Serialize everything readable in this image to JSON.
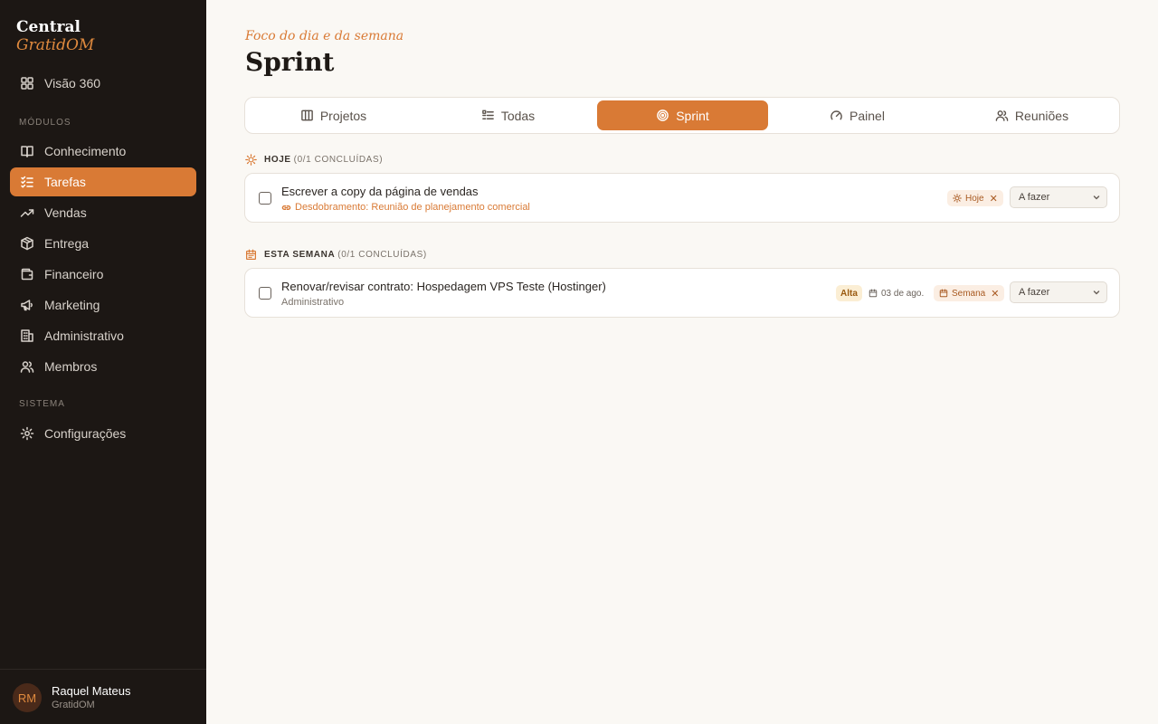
{
  "brand": {
    "line1": "Central",
    "line2": "GratidOM"
  },
  "sidebar": {
    "top_item": {
      "label": "Visão 360",
      "icon": "grid-icon"
    },
    "modules_label": "MÓDULOS",
    "modules": [
      {
        "label": "Conhecimento",
        "icon": "book-icon"
      },
      {
        "label": "Tarefas",
        "icon": "list-check-icon",
        "active": true
      },
      {
        "label": "Vendas",
        "icon": "trending-up-icon"
      },
      {
        "label": "Entrega",
        "icon": "package-icon"
      },
      {
        "label": "Financeiro",
        "icon": "wallet-icon"
      },
      {
        "label": "Marketing",
        "icon": "megaphone-icon"
      },
      {
        "label": "Administrativo",
        "icon": "building-icon"
      },
      {
        "label": "Membros",
        "icon": "users-icon"
      }
    ],
    "system_label": "SISTEMA",
    "system": [
      {
        "label": "Configurações",
        "icon": "gear-icon"
      }
    ]
  },
  "user": {
    "initials": "RM",
    "name": "Raquel Mateus",
    "org": "GratidOM"
  },
  "header": {
    "eyebrow": "Foco do dia e da semana",
    "title": "Sprint"
  },
  "tabs": [
    {
      "label": "Projetos",
      "icon": "columns-icon"
    },
    {
      "label": "Todas",
      "icon": "list-icon"
    },
    {
      "label": "Sprint",
      "icon": "target-icon",
      "active": true
    },
    {
      "label": "Painel",
      "icon": "gauge-icon"
    },
    {
      "label": "Reuniões",
      "icon": "users-icon"
    }
  ],
  "groups": {
    "today": {
      "name": "HOJE",
      "count": "(0/1 CONCLUÍDAS)",
      "tasks": [
        {
          "title": "Escrever a copy da página de vendas",
          "subtitle": "Desdobramento: Reunião de planejamento comercial",
          "focus_chip": "Hoje",
          "status": "A fazer"
        }
      ]
    },
    "week": {
      "name": "ESTA SEMANA",
      "count": "(0/1 CONCLUÍDAS)",
      "tasks": [
        {
          "title": "Renovar/revisar contrato: Hospedagem VPS Teste (Hostinger)",
          "subtitle": "Administrativo",
          "priority": "Alta",
          "due": "03 de ago.",
          "focus_chip": "Semana",
          "status": "A fazer"
        }
      ]
    }
  },
  "colors": {
    "accent": "#d97a35",
    "sidebar_bg": "#1c1714",
    "page_bg": "#faf8f4"
  }
}
